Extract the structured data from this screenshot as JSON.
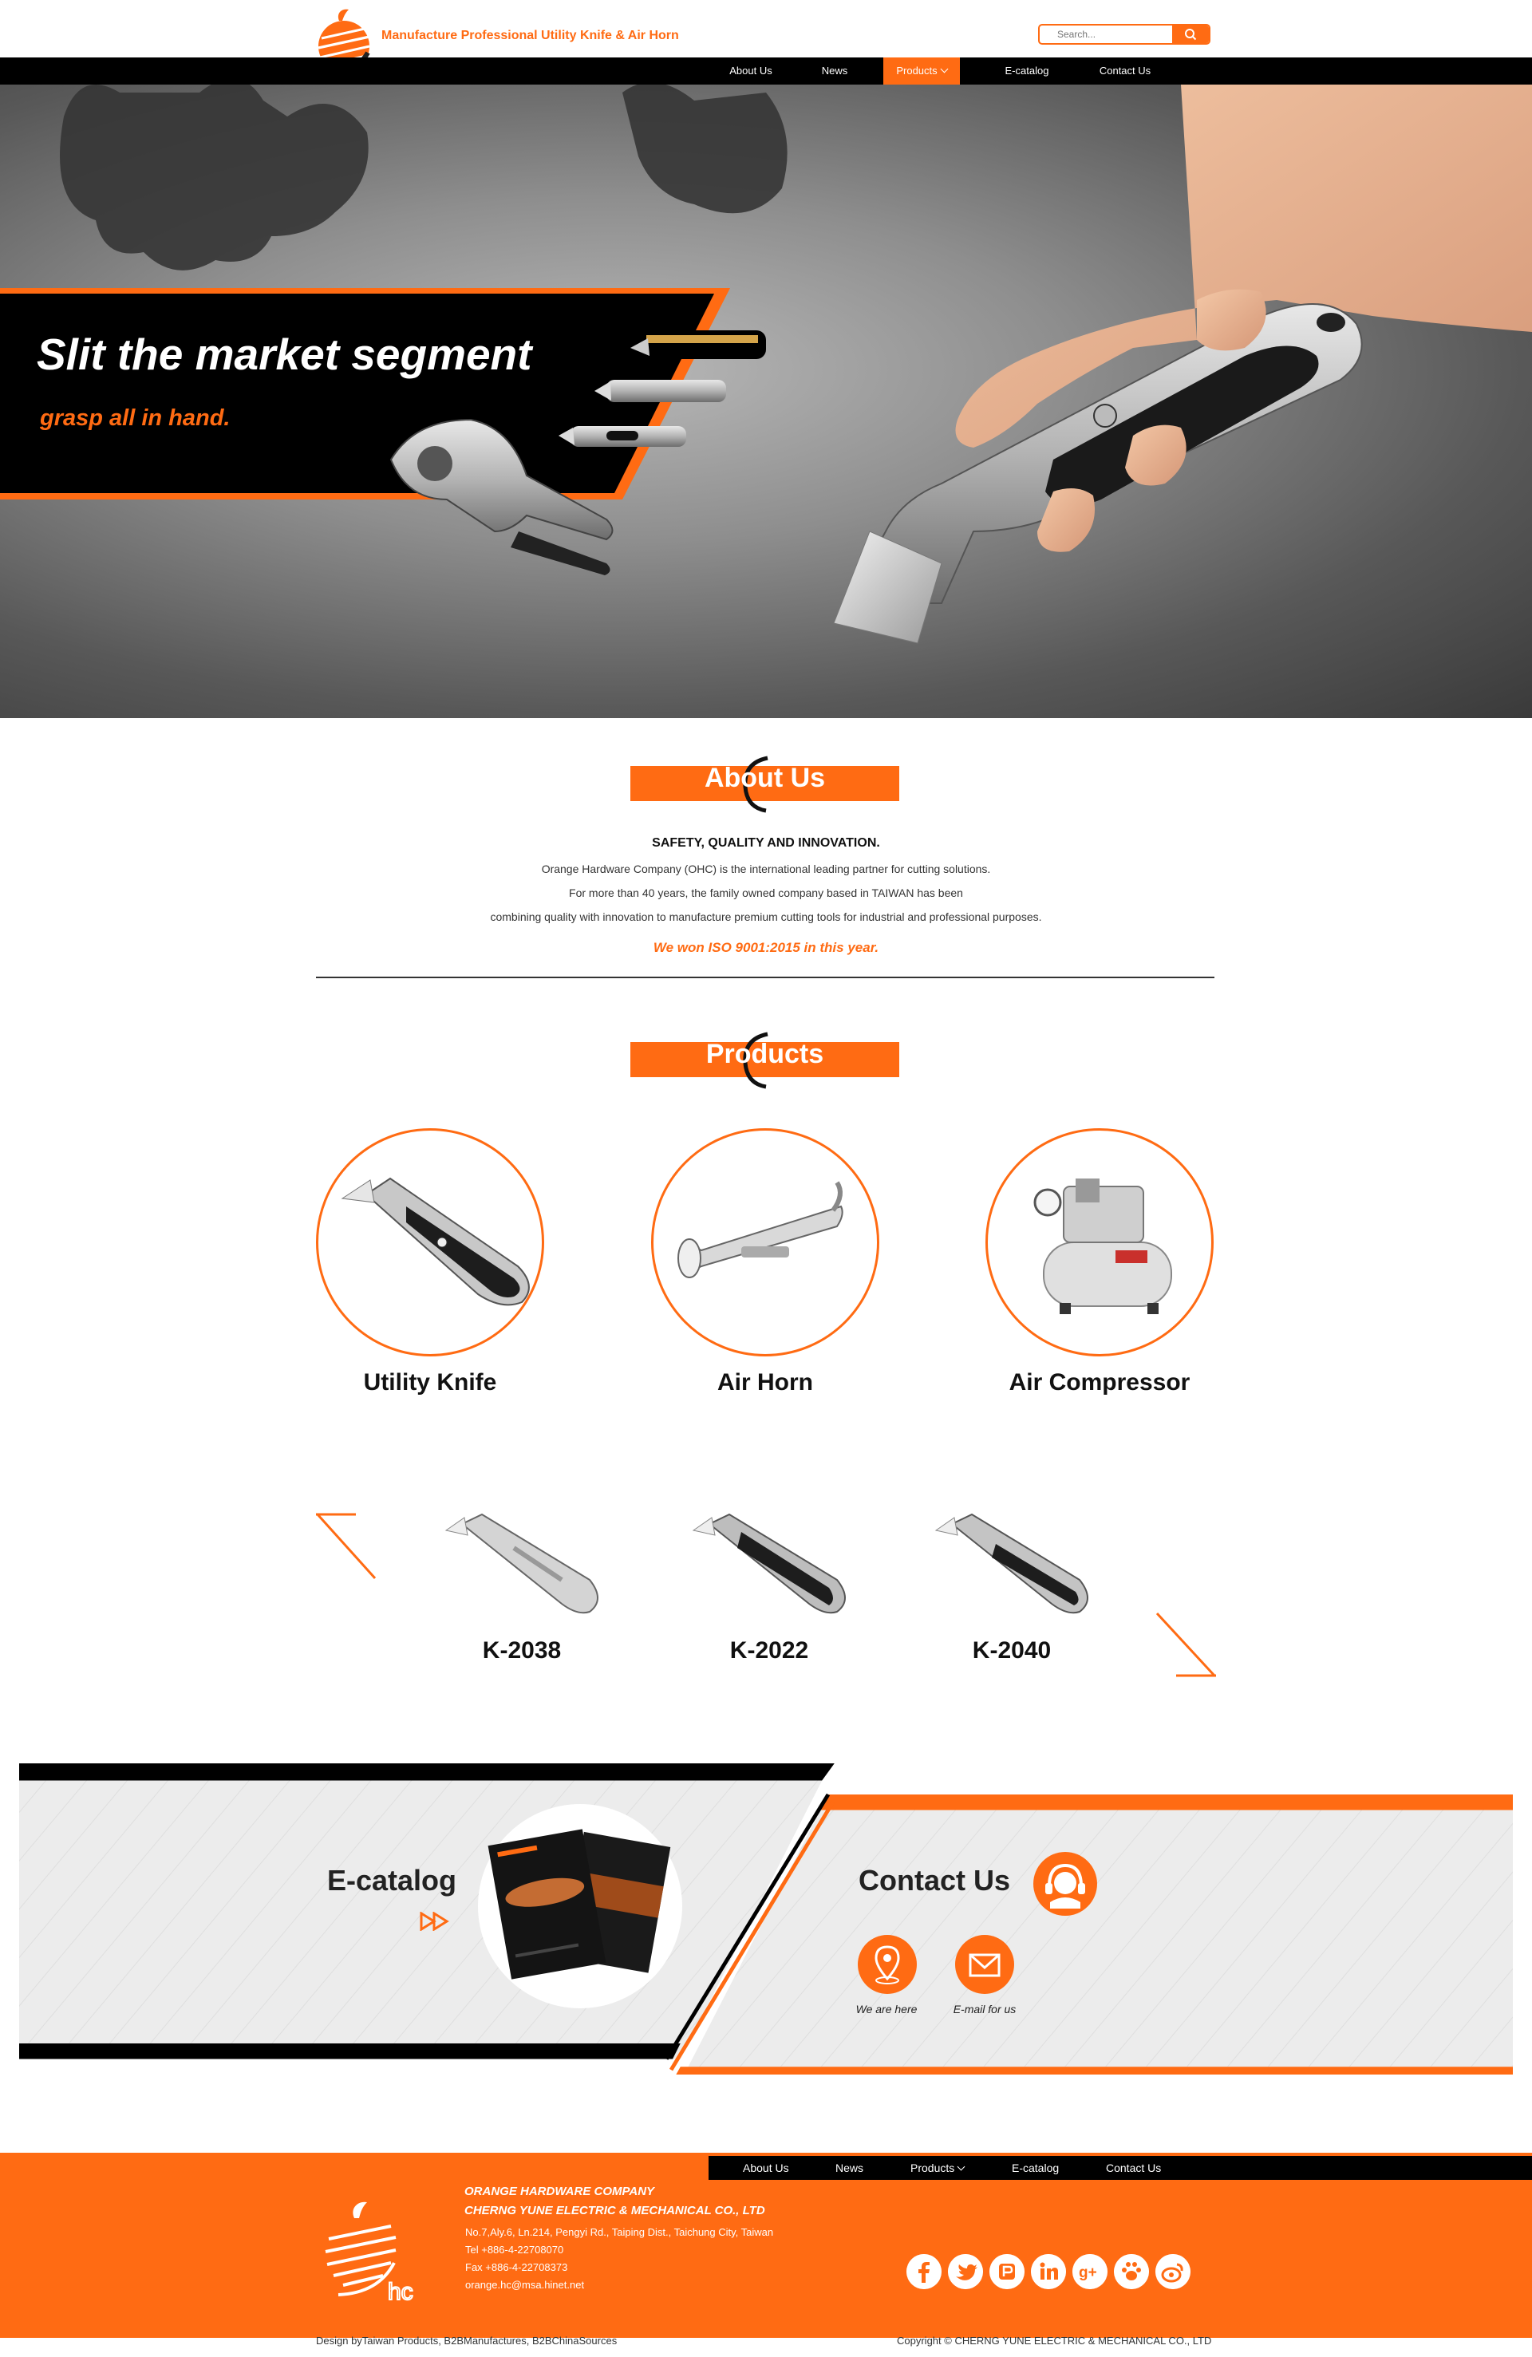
{
  "header": {
    "tagline": "Manufacture Professional Utility Knife & Air Horn",
    "search_placeholder": "Search...",
    "colors": {
      "accent": "#ff6b13",
      "nav_bg": "#000000"
    }
  },
  "nav": {
    "items": [
      {
        "label": "About Us"
      },
      {
        "label": "News"
      },
      {
        "label": "Products",
        "active": true,
        "dropdown": true
      },
      {
        "label": "E-catalog"
      },
      {
        "label": "Contact Us"
      }
    ]
  },
  "hero": {
    "title": "Slit the market segment",
    "subtitle": "grasp all in hand."
  },
  "about": {
    "title": "About Us",
    "heading": "SAFETY, QUALITY AND INNOVATION.",
    "lines": [
      "Orange Hardware Company (OHC) is the international leading partner for cutting solutions.",
      "For more than 40 years, the family owned company based in TAIWAN has been",
      "combining quality with innovation to manufacture premium cutting tools for industrial and professional purposes."
    ],
    "award": "We won ISO 9001:2015 in this year."
  },
  "products": {
    "title": "Products",
    "categories": [
      {
        "name": "Utility Knife",
        "icon": "utility-knife-image"
      },
      {
        "name": "Air Horn",
        "icon": "air-horn-image"
      },
      {
        "name": "Air Compressor",
        "icon": "air-compressor-image"
      }
    ],
    "models": [
      {
        "name": "K-2038"
      },
      {
        "name": "K-2022"
      },
      {
        "name": "K-2040"
      }
    ]
  },
  "ecatalog": {
    "title": "E-catalog",
    "icon": "double-arrow-icon"
  },
  "contact": {
    "title": "Contact Us",
    "icon": "headset-icon",
    "links": [
      {
        "label": "We are here",
        "icon": "map-pin-icon"
      },
      {
        "label": "E-mail for us",
        "icon": "envelope-icon"
      }
    ]
  },
  "footer": {
    "nav": [
      {
        "label": "About Us"
      },
      {
        "label": "News"
      },
      {
        "label": "Products",
        "dropdown": true
      },
      {
        "label": "E-catalog"
      },
      {
        "label": "Contact Us"
      }
    ],
    "company_1": "ORANGE HARDWARE COMPANY",
    "company_2": "CHERNG YUNE ELECTRIC & MECHANICAL CO., LTD",
    "address": "No.7,Aly.6, Ln.214, Pengyi Rd., Taiping Dist., Taichung City, Taiwan",
    "tel": "Tel  +886-4-22708070",
    "fax": "Fax +886-4-22708373",
    "email": "orange.hc@msa.hinet.net",
    "social": [
      "facebook-icon",
      "twitter-icon",
      "flickr-icon",
      "linkedin-icon",
      "google-plus-icon",
      "paw-icon",
      "weibo-icon"
    ],
    "design_credit": "Design byTaiwan Products, B2BManufactures, B2BChinaSources",
    "copyright": "Copyright © CHERNG YUNE ELECTRIC & MECHANICAL CO., LTD"
  }
}
